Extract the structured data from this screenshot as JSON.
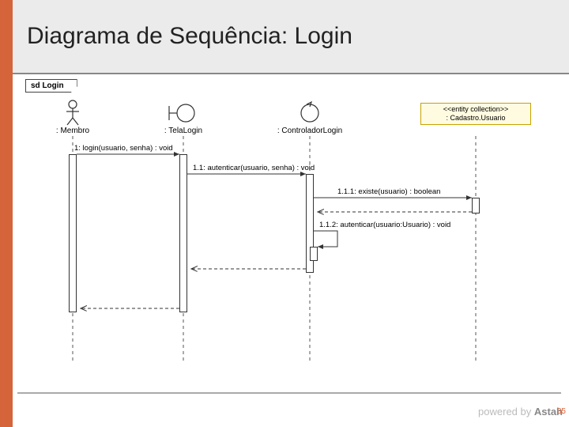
{
  "title": "Diagrama de Sequência: Login",
  "frame_label": "sd Login",
  "lifelines": {
    "membro": ": Membro",
    "tela": ": TelaLogin",
    "controlador": ": ControladorLogin",
    "cadastro_stereotype": "<<entity collection>>",
    "cadastro_name": ": Cadastro.Usuario"
  },
  "messages": {
    "m1": "1: login(usuario, senha) : void",
    "m11": "1.1: autenticar(usuario, senha) : void",
    "m111": "1.1.1: existe(usuario) : boolean",
    "m112": "1.1.2: autenticar(usuario:Usuario) : void"
  },
  "watermark_prefix": "powered by ",
  "watermark_brand": "Astah",
  "page_number": "35",
  "chart_data": {
    "type": "sequence-diagram",
    "frame": "sd Login",
    "lifelines": [
      {
        "id": "membro",
        "label": ": Membro",
        "kind": "actor"
      },
      {
        "id": "tela",
        "label": ": TelaLogin",
        "kind": "boundary"
      },
      {
        "id": "controlador",
        "label": ": ControladorLogin",
        "kind": "control"
      },
      {
        "id": "cadastro",
        "label": ": Cadastro.Usuario",
        "kind": "entity",
        "stereotype": "<<entity collection>>"
      }
    ],
    "messages": [
      {
        "seq": "1",
        "from": "membro",
        "to": "tela",
        "label": "login(usuario, senha)",
        "return": "void",
        "type": "sync"
      },
      {
        "seq": "1.1",
        "from": "tela",
        "to": "controlador",
        "label": "autenticar(usuario, senha)",
        "return": "void",
        "type": "sync"
      },
      {
        "seq": "1.1.1",
        "from": "controlador",
        "to": "cadastro",
        "label": "existe(usuario)",
        "return": "boolean",
        "type": "sync"
      },
      {
        "seq": "1.1.2",
        "from": "controlador",
        "to": "controlador",
        "label": "autenticar(usuario:Usuario)",
        "return": "void",
        "type": "self"
      }
    ]
  }
}
